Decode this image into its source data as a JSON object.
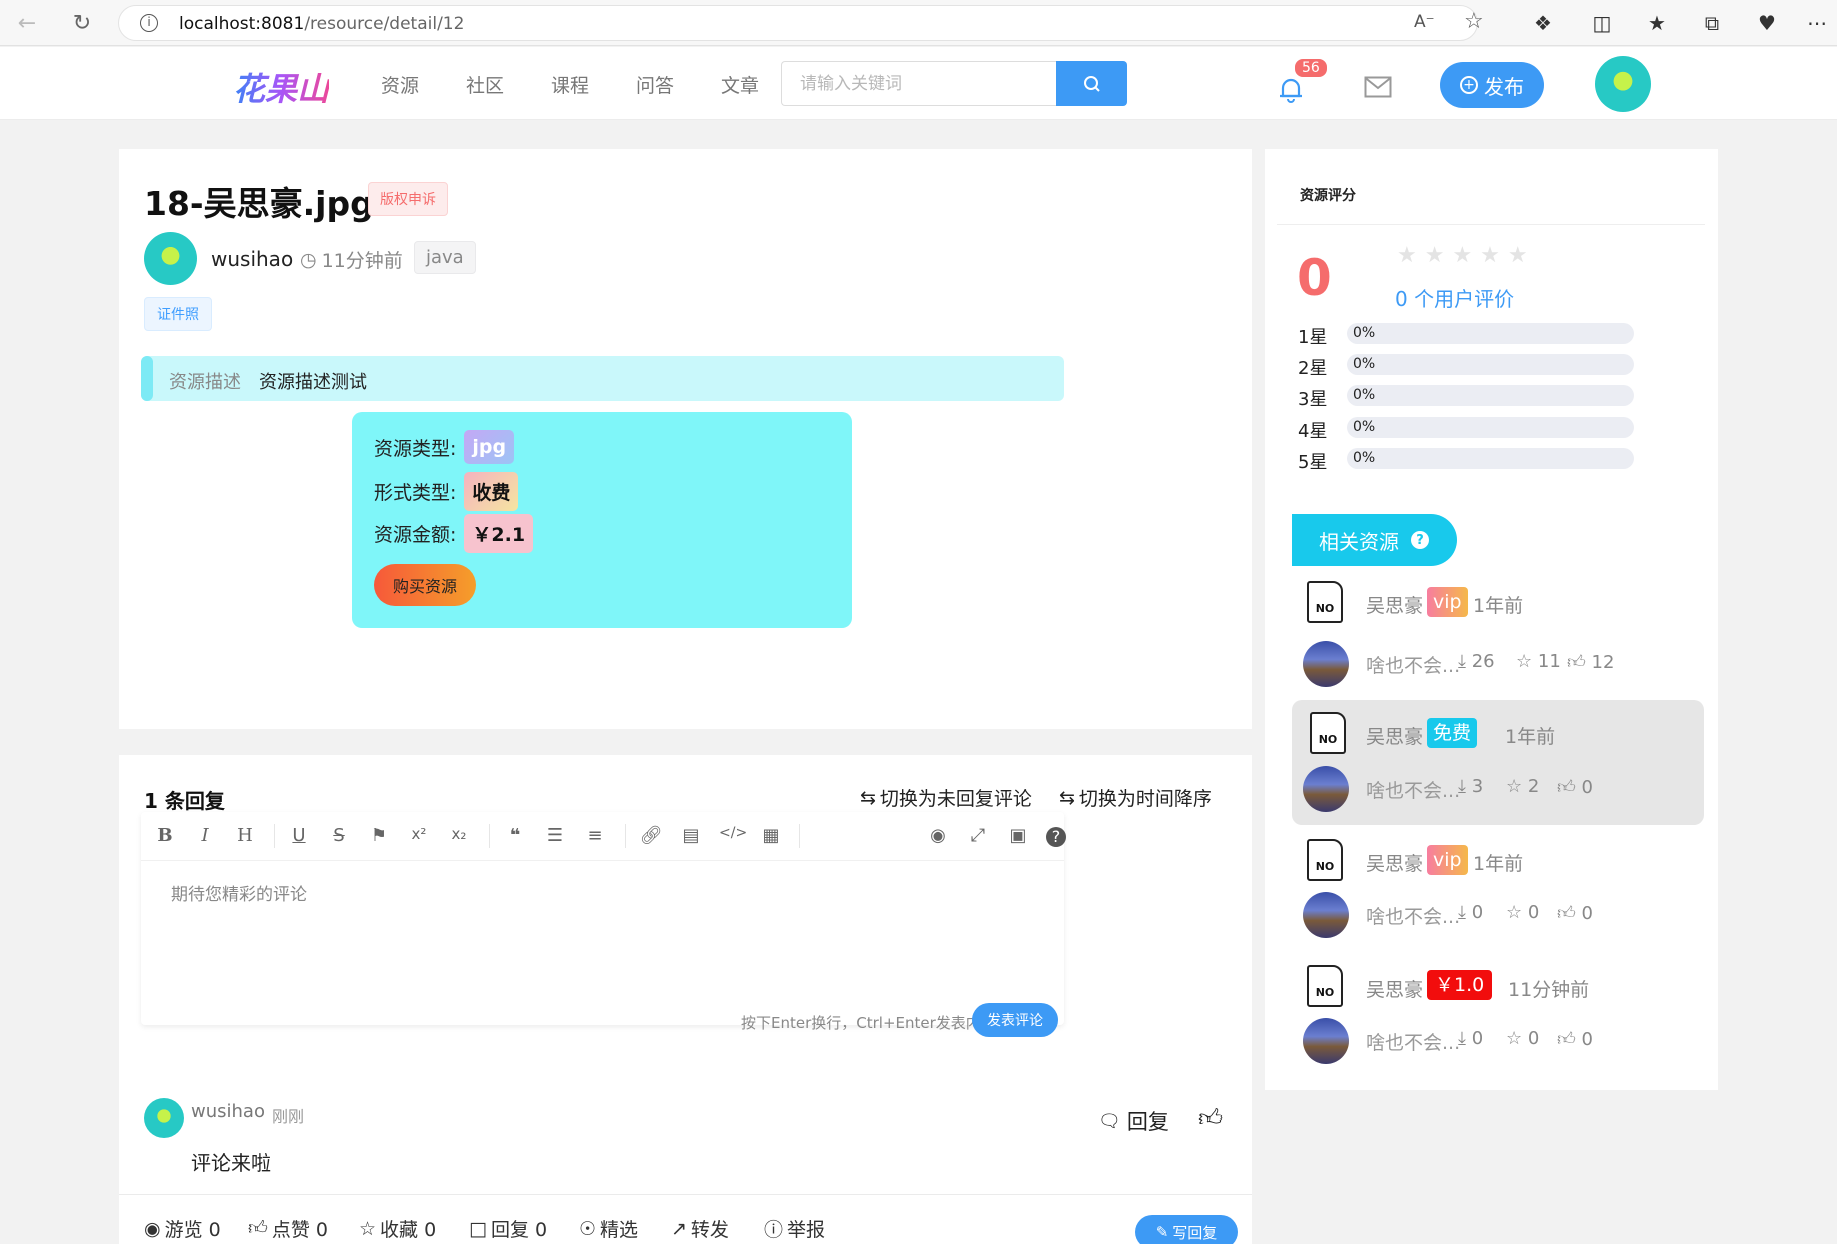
{
  "browser": {
    "url_host": "localhost:8081",
    "url_path": "/resource/detail/12"
  },
  "header": {
    "logo": "花果山",
    "nav": [
      "资源",
      "社区",
      "课程",
      "问答",
      "文章"
    ],
    "search_placeholder": "请输入关键词",
    "notification_count": "56",
    "publish_label": "发布"
  },
  "resource": {
    "title": "18-吴思豪.jpg",
    "copyright_tag": "版权申诉",
    "author": "wusihao",
    "time": "11分钟前",
    "tag": "java",
    "category": "证件照",
    "desc_label": "资源描述",
    "desc_text": "资源描述测试",
    "info": {
      "type_label": "资源类型:",
      "type_value": "jpg",
      "form_label": "形式类型:",
      "form_value": "收费",
      "price_label": "资源金额:",
      "price_value": "￥2.1",
      "buy_label": "购买资源"
    }
  },
  "comments": {
    "count_title": "1 条回复",
    "toggle_unreplied": "切换为未回复评论",
    "toggle_time": "切换为时间降序",
    "editor_placeholder": "期待您精彩的评论",
    "hint": "按下Enter换行，Ctrl+Enter发表内容",
    "post_label": "发表评论",
    "items": [
      {
        "user": "wusihao",
        "time": "刚刚",
        "text": "评论来啦",
        "reply_label": "回复"
      }
    ]
  },
  "bottom_bar": {
    "views": "游览 0",
    "likes": "点赞 0",
    "favorites": "收藏 0",
    "replies": "回复 0",
    "featured": "精选",
    "share": "转发",
    "report": "举报",
    "write_reply": "写回复"
  },
  "rating": {
    "title": "资源评分",
    "score": "0",
    "user_count_text": "0 个用户评价",
    "star_rows": [
      {
        "label": "1星",
        "percent": "0%"
      },
      {
        "label": "2星",
        "percent": "0%"
      },
      {
        "label": "3星",
        "percent": "0%"
      },
      {
        "label": "4星",
        "percent": "0%"
      },
      {
        "label": "5星",
        "percent": "0%"
      }
    ]
  },
  "related": {
    "title": "相关资源",
    "items": [
      {
        "author": "吴思豪",
        "badge": "vip",
        "time": "1年前",
        "name": "啥也不会...",
        "downloads": "26",
        "stars": "11",
        "likes": "12",
        "highlight": false
      },
      {
        "author": "吴思豪",
        "badge": "免费",
        "time": "1年前",
        "name": "啥也不会...",
        "downloads": "3",
        "stars": "2",
        "likes": "0",
        "highlight": true
      },
      {
        "author": "吴思豪",
        "badge": "vip",
        "time": "1年前",
        "name": "啥也不会...",
        "downloads": "0",
        "stars": "0",
        "likes": "0",
        "highlight": false
      },
      {
        "author": "吴思豪",
        "badge": "￥1.0",
        "time": "11分钟前",
        "name": "啥也不会...",
        "downloads": "0",
        "stars": "0",
        "likes": "0",
        "highlight": false
      }
    ]
  },
  "colors": {
    "accent": "#3d9af5",
    "score": "#f56c6c",
    "info_box": "#7ff6f9",
    "related_header": "#18c9ec"
  }
}
